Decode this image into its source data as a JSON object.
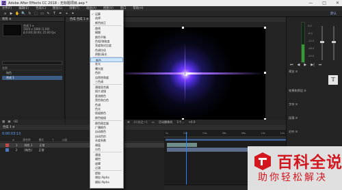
{
  "window": {
    "app_icon": "Ae",
    "title": "Adobe After Effects CC 2018 - 无标题项目.aep *",
    "controls": [
      "—",
      "□",
      "✕"
    ]
  },
  "menu": [
    "文件(F)",
    "编辑(E)",
    "合成(C)",
    "图层(L)",
    "效果(T)",
    "动画(A)",
    "视图(V)",
    "窗口",
    "帮助(H)"
  ],
  "toolbar": {
    "tools": [
      "⌂",
      "▶",
      "✋",
      "🔍",
      "↻",
      "⬚",
      "▭",
      "✎",
      "T",
      "✒",
      "⌖",
      "✦"
    ],
    "workspace": "默认"
  },
  "project": {
    "tab": "项目 ≡",
    "comp_name": "合成 1 ▾",
    "comp_info": [
      "1920 x 1080 (1.00)",
      "Δ 0:00:30:00, 25.00 fps"
    ],
    "header": "名称",
    "rows": [
      {
        "name": "纯色",
        "selected": false
      },
      {
        "name": "合成 1",
        "selected": true
      }
    ],
    "bottom_icons": [
      "▦",
      "▣",
      "⌫"
    ]
  },
  "composition": {
    "tab": "合成 合成 1 ≡",
    "footer": [
      "⊕",
      "(二分之一)",
      "▭",
      "活动摄像机",
      "1个...",
      "+0.0"
    ]
  },
  "context_menu": {
    "items": [
      {
        "label": "运算",
        "checked": true,
        "highlight": false,
        "sep_after": false
      },
      {
        "label": "选择",
        "checked": false,
        "highlight": false,
        "sep_after": false
      },
      {
        "label": "颜色校正",
        "checked": false,
        "highlight": false,
        "sep_after": true
      },
      {
        "label": "曲线",
        "checked": false,
        "highlight": false,
        "sep_after": false
      },
      {
        "label": "模糊",
        "checked": false,
        "highlight": false,
        "sep_after": false
      },
      {
        "label": "颜色平衡",
        "checked": false,
        "highlight": false,
        "sep_after": false
      },
      {
        "label": "色相/饱和度",
        "checked": false,
        "highlight": false,
        "sep_after": false
      },
      {
        "label": "亮度和对比度",
        "checked": false,
        "highlight": false,
        "sep_after": false
      },
      {
        "label": "色调均化",
        "checked": false,
        "highlight": false,
        "sep_after": false
      },
      {
        "label": "阴影/高光",
        "checked": false,
        "highlight": false,
        "sep_after": true
      },
      {
        "label": "颜色",
        "checked": false,
        "highlight": true,
        "sep_after": false
      },
      {
        "label": "发光",
        "checked": false,
        "highlight": false,
        "sep_after": false
      },
      {
        "label": "曝光度",
        "checked": false,
        "highlight": false,
        "sep_after": false
      },
      {
        "label": "色阶",
        "checked": false,
        "highlight": false,
        "sep_after": false
      },
      {
        "label": "自然饱和度",
        "checked": false,
        "highlight": false,
        "sep_after": false
      },
      {
        "label": "三色调",
        "checked": false,
        "highlight": false,
        "sep_after": true
      },
      {
        "label": "通道混合器",
        "checked": false,
        "highlight": false,
        "sep_after": false
      },
      {
        "label": "照片滤镜",
        "checked": false,
        "highlight": false,
        "sep_after": false
      },
      {
        "label": "更改颜色",
        "checked": false,
        "highlight": false,
        "sep_after": false
      },
      {
        "label": "黑色和白色",
        "checked": false,
        "highlight": false,
        "sep_after": false
      },
      {
        "label": "色调",
        "checked": false,
        "highlight": false,
        "sep_after": false
      },
      {
        "label": "色光",
        "checked": false,
        "highlight": false,
        "sep_after": false
      },
      {
        "label": "保留颜色",
        "checked": false,
        "highlight": false,
        "sep_after": false
      },
      {
        "label": "颜色链接",
        "checked": false,
        "highlight": false,
        "sep_after": true
      },
      {
        "label": "颜色稳定器",
        "checked": false,
        "highlight": false,
        "sep_after": false
      },
      {
        "label": "广播颜色",
        "checked": false,
        "highlight": false,
        "sep_after": false
      },
      {
        "label": "自动颜色",
        "checked": false,
        "highlight": false,
        "sep_after": false
      },
      {
        "label": "自动色阶",
        "checked": false,
        "highlight": false,
        "sep_after": false
      },
      {
        "label": "灰度系数",
        "checked": false,
        "highlight": false,
        "sep_after": false
      },
      {
        "label": "阈值",
        "checked": false,
        "highlight": false,
        "sep_after": false
      },
      {
        "label": "分色",
        "checked": false,
        "highlight": false,
        "sep_after": true
      },
      {
        "label": "通道",
        "checked": false,
        "highlight": false,
        "sep_after": false
      },
      {
        "label": "键控",
        "checked": false,
        "highlight": false,
        "sep_after": false
      },
      {
        "label": "遮罩",
        "checked": false,
        "highlight": false,
        "sep_after": false
      },
      {
        "label": "过渡",
        "checked": false,
        "highlight": false,
        "sep_after": true
      },
      {
        "label": "提取",
        "checked": false,
        "highlight": false,
        "sep_after": false
      },
      {
        "label": "增加 Alpha",
        "checked": false,
        "highlight": false,
        "sep_after": false
      },
      {
        "label": "模拟 Alpha",
        "checked": false,
        "highlight": false,
        "sep_after": false
      }
    ]
  },
  "right_panel": {
    "meter_db": [
      "0.0",
      "-6.0",
      "-12.0",
      "-18.0",
      "-24.0"
    ],
    "meter_level": 0.45,
    "transport": [
      "⏮",
      "◀",
      "▶",
      "▶|",
      "⏭"
    ],
    "rows": [
      "预览 ≡",
      "效果和预设 ≡",
      "字符 ≡",
      "段落 ≡",
      "对齐 ≡"
    ],
    "text_tool_icon": "T"
  },
  "timeline": {
    "tab": "合成 1 ≡",
    "timecode": "0:00:03:13",
    "columns": [
      "#",
      "源名称",
      "模式",
      "T",
      "父级"
    ],
    "layers": [
      {
        "num": "1",
        "name": "纯色 1",
        "mode": "正常",
        "label_color": "#c44a4a",
        "selected": true
      },
      {
        "num": "2",
        "name": "[纯色]",
        "mode": "正常",
        "label_color": "#4a7ac4",
        "selected": false
      }
    ],
    "ruler": [
      "0s",
      "02s",
      "04s",
      "06s",
      "08s",
      "10s",
      "12s"
    ],
    "cti_pos": 0.18
  },
  "watermark": {
    "line1": "百科全说",
    "line2": "助你轻松解决"
  }
}
